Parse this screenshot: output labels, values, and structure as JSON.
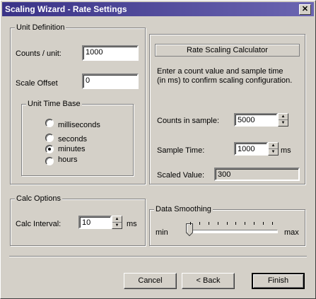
{
  "window": {
    "title": "Scaling Wizard - Rate Settings",
    "close_glyph": "✕"
  },
  "unit_definition": {
    "group_label": "Unit Definition",
    "counts_label": "Counts / unit:",
    "counts_value": "1000",
    "offset_label": "Scale Offset",
    "offset_value": "0"
  },
  "time_base": {
    "group_label": "Unit Time Base",
    "options": [
      {
        "label": "milliseconds",
        "selected": false
      },
      {
        "label": "seconds",
        "selected": false
      },
      {
        "label": "minutes",
        "selected": true
      },
      {
        "label": "hours",
        "selected": false
      }
    ]
  },
  "calculator": {
    "title": "Rate Scaling Calculator",
    "description": "Enter a count value and sample time (in ms) to confirm scaling configuration.",
    "counts_label": "Counts in sample:",
    "counts_value": "5000",
    "sample_label": "Sample Time:",
    "sample_value": "1000",
    "sample_unit": "ms",
    "scaled_label": "Scaled Value:",
    "scaled_value": "300"
  },
  "calc_options": {
    "group_label": "Calc Options",
    "interval_label": "Calc Interval:",
    "interval_value": "10",
    "interval_unit": "ms"
  },
  "smoothing": {
    "group_label": "Data Smoothing",
    "min_label": "min",
    "max_label": "max",
    "level": 0
  },
  "buttons": {
    "cancel": "Cancel",
    "back": "< Back",
    "finish": "Finish"
  },
  "colors": {
    "title_start": "#3a3387",
    "title_end": "#6b65b1",
    "face": "#d4d0c8"
  }
}
